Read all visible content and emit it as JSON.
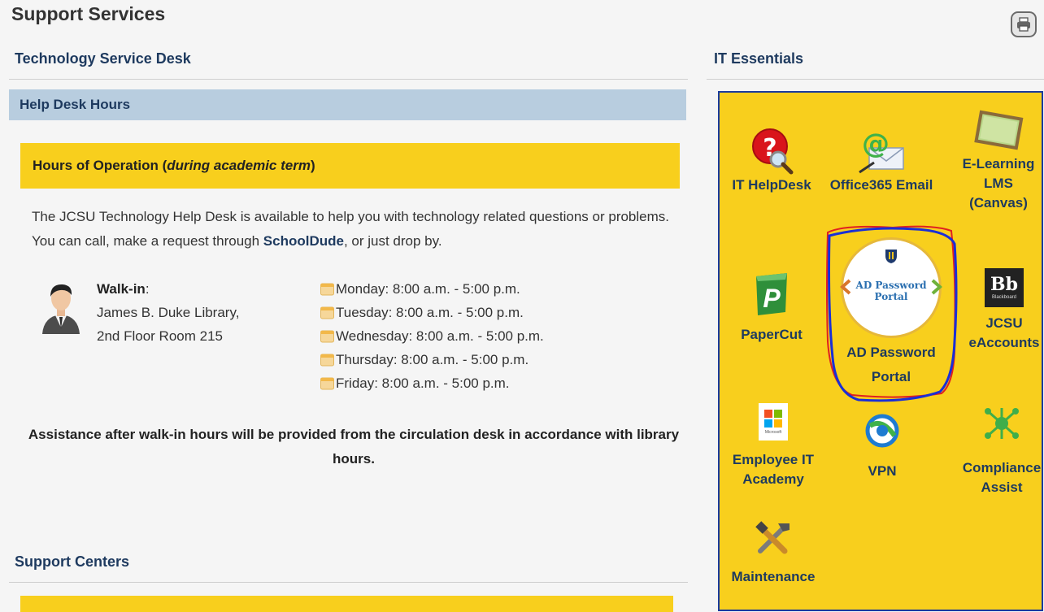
{
  "page": {
    "title": "Support Services"
  },
  "left": {
    "section_title": "Technology Service Desk",
    "help_bar": "Help Desk Hours",
    "hours_heading": {
      "prefix": "Hours of Operation (",
      "italic": "during academic term",
      "suffix": ")"
    },
    "description": {
      "before": "The JCSU Technology Help Desk is available to help you with technology related questions or problems. You can call, make a request through ",
      "link": "SchoolDude",
      "after": ", or just drop by."
    },
    "walkin": {
      "label": "Walk-in",
      "colon": ":",
      "line1": "James B. Duke Library,",
      "line2": "2nd Floor Room 215"
    },
    "hours": [
      "Monday: 8:00 a.m. - 5:00 p.m.",
      "Tuesday: 8:00 a.m. - 5:00 p.m.",
      "Wednesday: 8:00 a.m. - 5:00 p.m.",
      "Thursday: 8:00 a.m. - 5:00 p.m.",
      "Friday: 8:00 a.m. - 5:00 p.m."
    ],
    "assistance": "Assistance after walk-in hours will be provided from the circulation desk in accordance with library hours.",
    "support_centers": "Support Centers"
  },
  "right": {
    "section_title": "IT Essentials",
    "tiles": {
      "helpdesk": [
        "IT HelpDesk"
      ],
      "office365": [
        "Office365 Email"
      ],
      "elearning": [
        "E-Learning",
        "LMS",
        "(Canvas)"
      ],
      "papercut": [
        "PaperCut"
      ],
      "adportal": [
        "AD Password",
        "Portal"
      ],
      "eaccounts": [
        "JCSU",
        "eAccounts"
      ],
      "academy": [
        "Employee IT",
        "Academy"
      ],
      "vpn": [
        "VPN"
      ],
      "compliance": [
        "Compliance",
        "Assist"
      ],
      "maintenance": [
        "Maintenance"
      ]
    },
    "ad_logo": {
      "line1": "AD Password",
      "line2": "Portal"
    },
    "bb_logo": {
      "mark": "Bb",
      "word": "Blackboard"
    },
    "ms_logo": {
      "word": "Microsoft"
    }
  },
  "icons": {
    "print": "printer-icon",
    "avatar": "person-avatar-icon",
    "calendar": "calendar-icon"
  },
  "colors": {
    "heading": "#1e3a5f",
    "help_bar_bg": "#b8cddf",
    "yellow": "#f8cf1d",
    "panel_border": "#1a3b9e",
    "annotation_red": "#e02020",
    "annotation_blue": "#1a2fd6"
  }
}
